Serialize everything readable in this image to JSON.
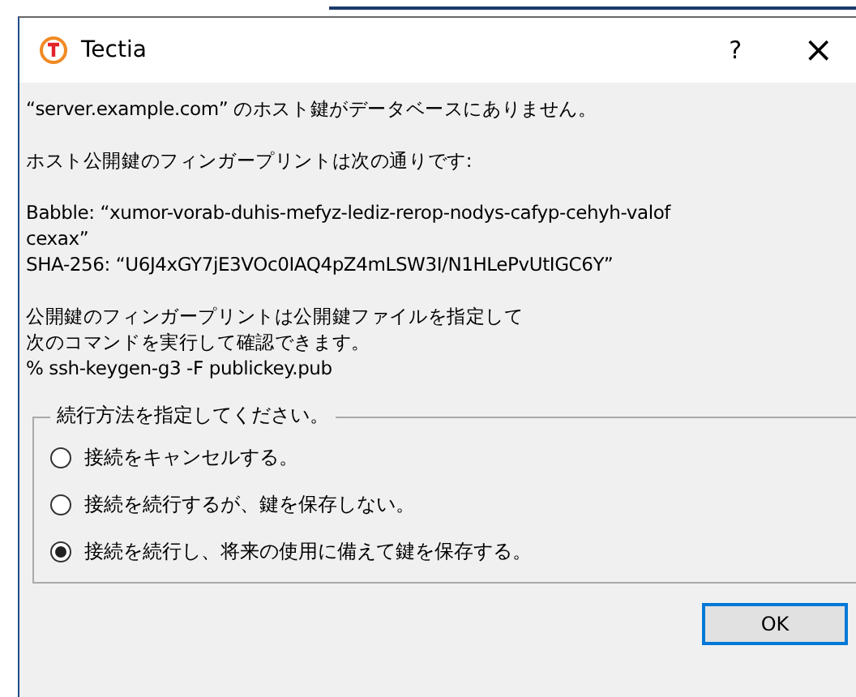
{
  "window": {
    "title": "Tectia",
    "help": "?",
    "close": "×"
  },
  "paragraphs": [
    [
      "“server.example.com” のホスト鍵がデータベースにありません。"
    ],
    [
      "ホスト公開鍵のフィンガープリントは次の通りです:"
    ],
    [
      "Babble: “xumor-vorab-duhis-mefyz-lediz-rerop-nodys-cafyp-cehyh-valof",
      "cexax”",
      "SHA-256: “U6J4xGY7jE3VOc0IAQ4pZ4mLSW3I/N1HLePvUtIGC6Y”"
    ],
    [
      "公開鍵のフィンガープリントは公開鍵ファイルを指定して",
      "次のコマンドを実行して確認できます。",
      "% ssh-keygen-g3 -F publickey.pub"
    ]
  ],
  "group": {
    "legend": "続行方法を指定してください。",
    "options": [
      {
        "label": "接続をキャンセルする。",
        "selected": false
      },
      {
        "label": "接続を続行するが、鍵を保存しない。",
        "selected": false
      },
      {
        "label": "接続を続行し、将来の使用に備えて鍵を保存する。",
        "selected": true
      }
    ]
  },
  "buttons": [
    "OK"
  ]
}
